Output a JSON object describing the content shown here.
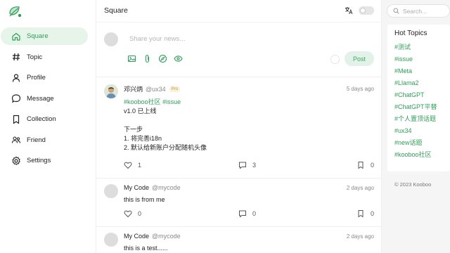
{
  "brand": {
    "logo_icon": "leaf-logo-icon",
    "accent": "#2f9d58"
  },
  "sidebar": {
    "items": [
      {
        "label": "Square",
        "icon": "home-icon",
        "active": true
      },
      {
        "label": "Topic",
        "icon": "hash-icon",
        "active": false
      },
      {
        "label": "Profile",
        "icon": "user-icon",
        "active": false
      },
      {
        "label": "Message",
        "icon": "chat-bubble-icon",
        "active": false
      },
      {
        "label": "Collection",
        "icon": "bookmark-icon",
        "active": false
      },
      {
        "label": "Friend",
        "icon": "friends-icon",
        "active": false
      },
      {
        "label": "Settings",
        "icon": "gear-icon",
        "active": false
      }
    ]
  },
  "header": {
    "title": "Square"
  },
  "composer": {
    "placeholder": "Share your news...",
    "post_label": "Post"
  },
  "posts": [
    {
      "name": "邓兴炳",
      "handle": "@ux34",
      "badge": "Pro",
      "time": "5 days ago",
      "tags": [
        "#kooboo社区",
        "#issue"
      ],
      "text": "v1.0 已上线\n\n下一步\n1. 将完善i18n\n2. 默认给新账户分配随机头像",
      "likes": "1",
      "comments": "3",
      "bookmarks": "0"
    },
    {
      "name": "My Code",
      "handle": "@mycode",
      "badge": "",
      "time": "2 days ago",
      "tags": [],
      "text": "this is from me",
      "likes": "0",
      "comments": "0",
      "bookmarks": "0"
    },
    {
      "name": "My Code",
      "handle": "@mycode",
      "badge": "",
      "time": "2 days ago",
      "tags": [],
      "text": "this is a test......",
      "likes": "",
      "comments": "",
      "bookmarks": ""
    }
  ],
  "right": {
    "search_placeholder": "Search...",
    "hot_topics_title": "Hot Topics",
    "topics": [
      "#测试",
      "#issue",
      "#Meta",
      "#Llama2",
      "#ChatGPT",
      "#ChatGPT平替",
      "#个人置顶话题",
      "#ux34",
      "#new话题",
      "#kooboo社区"
    ],
    "copyright": "© 2023 Kooboo"
  }
}
